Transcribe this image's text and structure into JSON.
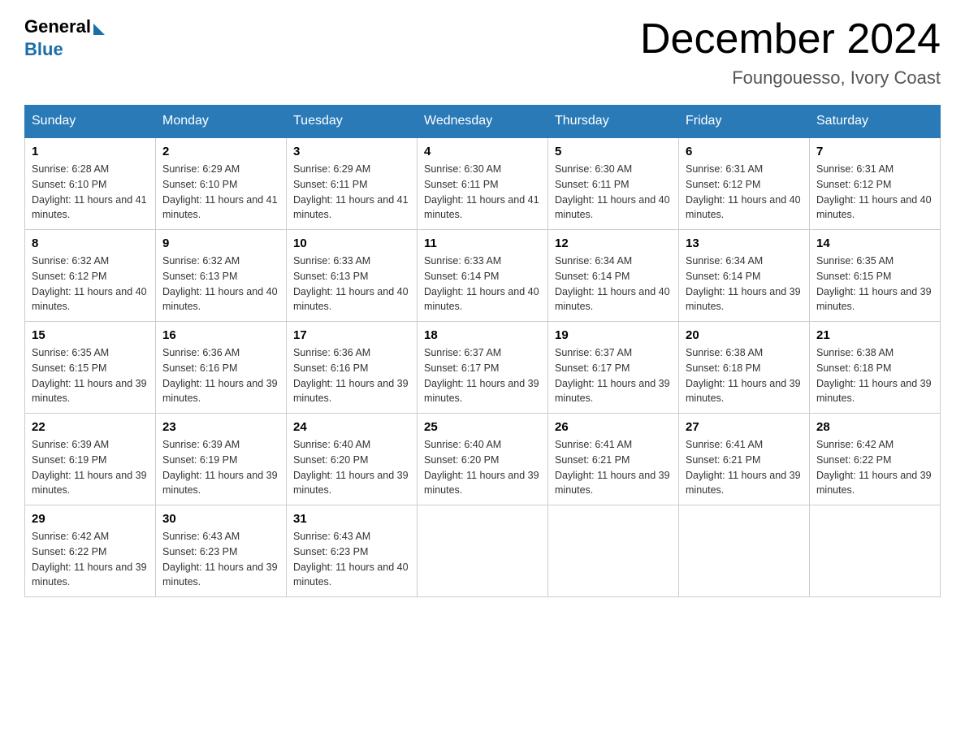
{
  "logo": {
    "general": "General",
    "blue": "Blue"
  },
  "title": "December 2024",
  "location": "Foungouesso, Ivory Coast",
  "days_of_week": [
    "Sunday",
    "Monday",
    "Tuesday",
    "Wednesday",
    "Thursday",
    "Friday",
    "Saturday"
  ],
  "weeks": [
    [
      {
        "day": "1",
        "sunrise": "6:28 AM",
        "sunset": "6:10 PM",
        "daylight": "11 hours and 41 minutes."
      },
      {
        "day": "2",
        "sunrise": "6:29 AM",
        "sunset": "6:10 PM",
        "daylight": "11 hours and 41 minutes."
      },
      {
        "day": "3",
        "sunrise": "6:29 AM",
        "sunset": "6:11 PM",
        "daylight": "11 hours and 41 minutes."
      },
      {
        "day": "4",
        "sunrise": "6:30 AM",
        "sunset": "6:11 PM",
        "daylight": "11 hours and 41 minutes."
      },
      {
        "day": "5",
        "sunrise": "6:30 AM",
        "sunset": "6:11 PM",
        "daylight": "11 hours and 40 minutes."
      },
      {
        "day": "6",
        "sunrise": "6:31 AM",
        "sunset": "6:12 PM",
        "daylight": "11 hours and 40 minutes."
      },
      {
        "day": "7",
        "sunrise": "6:31 AM",
        "sunset": "6:12 PM",
        "daylight": "11 hours and 40 minutes."
      }
    ],
    [
      {
        "day": "8",
        "sunrise": "6:32 AM",
        "sunset": "6:12 PM",
        "daylight": "11 hours and 40 minutes."
      },
      {
        "day": "9",
        "sunrise": "6:32 AM",
        "sunset": "6:13 PM",
        "daylight": "11 hours and 40 minutes."
      },
      {
        "day": "10",
        "sunrise": "6:33 AM",
        "sunset": "6:13 PM",
        "daylight": "11 hours and 40 minutes."
      },
      {
        "day": "11",
        "sunrise": "6:33 AM",
        "sunset": "6:14 PM",
        "daylight": "11 hours and 40 minutes."
      },
      {
        "day": "12",
        "sunrise": "6:34 AM",
        "sunset": "6:14 PM",
        "daylight": "11 hours and 40 minutes."
      },
      {
        "day": "13",
        "sunrise": "6:34 AM",
        "sunset": "6:14 PM",
        "daylight": "11 hours and 39 minutes."
      },
      {
        "day": "14",
        "sunrise": "6:35 AM",
        "sunset": "6:15 PM",
        "daylight": "11 hours and 39 minutes."
      }
    ],
    [
      {
        "day": "15",
        "sunrise": "6:35 AM",
        "sunset": "6:15 PM",
        "daylight": "11 hours and 39 minutes."
      },
      {
        "day": "16",
        "sunrise": "6:36 AM",
        "sunset": "6:16 PM",
        "daylight": "11 hours and 39 minutes."
      },
      {
        "day": "17",
        "sunrise": "6:36 AM",
        "sunset": "6:16 PM",
        "daylight": "11 hours and 39 minutes."
      },
      {
        "day": "18",
        "sunrise": "6:37 AM",
        "sunset": "6:17 PM",
        "daylight": "11 hours and 39 minutes."
      },
      {
        "day": "19",
        "sunrise": "6:37 AM",
        "sunset": "6:17 PM",
        "daylight": "11 hours and 39 minutes."
      },
      {
        "day": "20",
        "sunrise": "6:38 AM",
        "sunset": "6:18 PM",
        "daylight": "11 hours and 39 minutes."
      },
      {
        "day": "21",
        "sunrise": "6:38 AM",
        "sunset": "6:18 PM",
        "daylight": "11 hours and 39 minutes."
      }
    ],
    [
      {
        "day": "22",
        "sunrise": "6:39 AM",
        "sunset": "6:19 PM",
        "daylight": "11 hours and 39 minutes."
      },
      {
        "day": "23",
        "sunrise": "6:39 AM",
        "sunset": "6:19 PM",
        "daylight": "11 hours and 39 minutes."
      },
      {
        "day": "24",
        "sunrise": "6:40 AM",
        "sunset": "6:20 PM",
        "daylight": "11 hours and 39 minutes."
      },
      {
        "day": "25",
        "sunrise": "6:40 AM",
        "sunset": "6:20 PM",
        "daylight": "11 hours and 39 minutes."
      },
      {
        "day": "26",
        "sunrise": "6:41 AM",
        "sunset": "6:21 PM",
        "daylight": "11 hours and 39 minutes."
      },
      {
        "day": "27",
        "sunrise": "6:41 AM",
        "sunset": "6:21 PM",
        "daylight": "11 hours and 39 minutes."
      },
      {
        "day": "28",
        "sunrise": "6:42 AM",
        "sunset": "6:22 PM",
        "daylight": "11 hours and 39 minutes."
      }
    ],
    [
      {
        "day": "29",
        "sunrise": "6:42 AM",
        "sunset": "6:22 PM",
        "daylight": "11 hours and 39 minutes."
      },
      {
        "day": "30",
        "sunrise": "6:43 AM",
        "sunset": "6:23 PM",
        "daylight": "11 hours and 39 minutes."
      },
      {
        "day": "31",
        "sunrise": "6:43 AM",
        "sunset": "6:23 PM",
        "daylight": "11 hours and 40 minutes."
      },
      null,
      null,
      null,
      null
    ]
  ]
}
